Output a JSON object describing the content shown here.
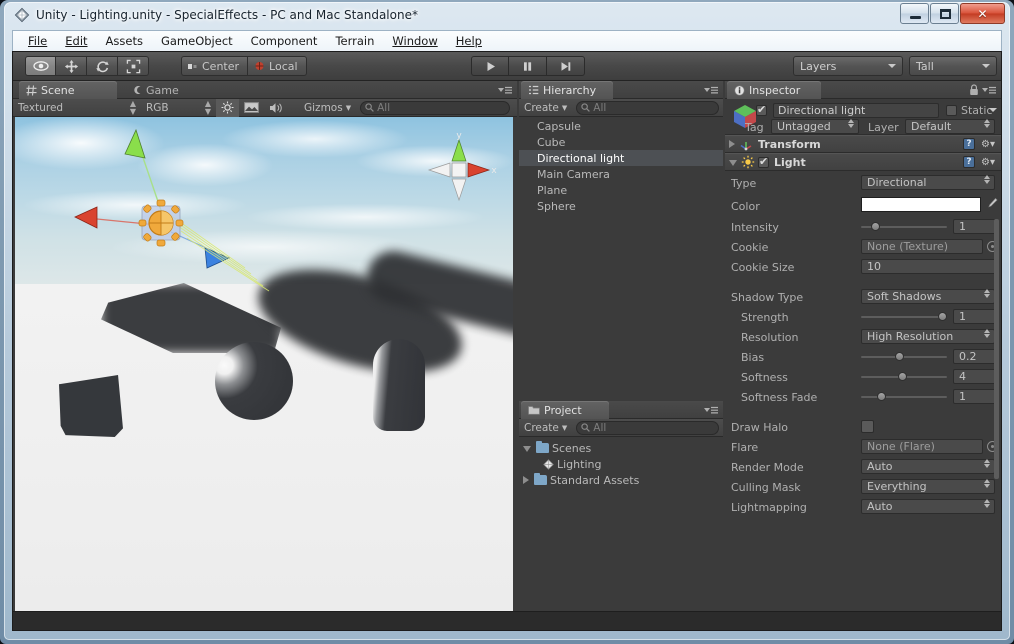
{
  "window": {
    "title": "Unity - Lighting.unity - SpecialEffects - PC and Mac Standalone*",
    "app_icon": "unity-logo-icon",
    "minimize_label": "Minimize",
    "maximize_label": "Maximize",
    "close_label": "✕"
  },
  "menu": {
    "items": [
      {
        "label": "File"
      },
      {
        "label": "Edit"
      },
      {
        "label": "Assets"
      },
      {
        "label": "GameObject"
      },
      {
        "label": "Component"
      },
      {
        "label": "Terrain"
      },
      {
        "label": "Window"
      },
      {
        "label": "Help"
      }
    ]
  },
  "toolbar": {
    "transform_tools": [
      {
        "name": "hand-tool",
        "icon": "eye-icon",
        "active": true
      },
      {
        "name": "move-tool",
        "icon": "move-arrows-icon",
        "active": false
      },
      {
        "name": "rotate-tool",
        "icon": "rotate-icon",
        "active": false
      },
      {
        "name": "scale-tool",
        "icon": "scale-icon",
        "active": false
      }
    ],
    "pivot_label": "Center",
    "rotation_label": "Local",
    "play_label": "play-icon",
    "pause_label": "pause-icon",
    "step_label": "step-icon",
    "layers_label": "Layers",
    "layout_label": "Tall"
  },
  "scene_panel": {
    "tabs": [
      {
        "label": "Scene",
        "icon": "grid-icon",
        "active": true
      },
      {
        "label": "Game",
        "icon": "gamepad-icon",
        "active": false
      }
    ],
    "draw_mode": "Textured",
    "render_mode": "RGB",
    "toggles": [
      {
        "name": "lighting-toggle",
        "icon": "sun-icon",
        "active": true
      },
      {
        "name": "skybox-toggle",
        "icon": "image-icon",
        "active": true
      },
      {
        "name": "audio-toggle",
        "icon": "speaker-icon",
        "active": false
      }
    ],
    "gizmos_label": "Gizmos",
    "search_placeholder": "All",
    "axis_gizmo": {
      "y_label": "y",
      "x_label": "x"
    }
  },
  "hierarchy_panel": {
    "tab_label": "Hierarchy",
    "tab_icon": "hierarchy-icon",
    "create_label": "Create",
    "search_placeholder": "All",
    "items": [
      {
        "label": "Capsule",
        "selected": false
      },
      {
        "label": "Cube",
        "selected": false
      },
      {
        "label": "Directional light",
        "selected": true
      },
      {
        "label": "Main Camera",
        "selected": false
      },
      {
        "label": "Plane",
        "selected": false
      },
      {
        "label": "Sphere",
        "selected": false
      }
    ]
  },
  "project_panel": {
    "tab_label": "Project",
    "tab_icon": "folder-icon",
    "create_label": "Create",
    "search_placeholder": "All",
    "items": [
      {
        "label": "Scenes",
        "type": "folder",
        "expanded": true,
        "depth": 0
      },
      {
        "label": "Lighting",
        "type": "scene",
        "expanded": false,
        "depth": 1
      },
      {
        "label": "Standard Assets",
        "type": "folder",
        "expanded": false,
        "depth": 0
      }
    ]
  },
  "inspector_panel": {
    "tab_label": "Inspector",
    "tab_icon": "info-icon",
    "lock_icon": "lock-icon",
    "object": {
      "enabled": true,
      "name": "Directional light",
      "static_label": "Static",
      "static_checked": false,
      "tag_label": "Tag",
      "tag_value": "Untagged",
      "layer_label": "Layer",
      "layer_value": "Default"
    },
    "components": [
      {
        "name": "Transform",
        "icon": "transform-icon",
        "expanded": false,
        "has_checkbox": false,
        "properties": []
      },
      {
        "name": "Light",
        "icon": "light-bulb-icon",
        "expanded": true,
        "has_checkbox": true,
        "checked": true,
        "properties": [
          {
            "label": "Type",
            "kind": "popup",
            "value": "Directional"
          },
          {
            "label": "Color",
            "kind": "color",
            "value": "#FFFFFF",
            "eyedropper": true
          },
          {
            "label": "Intensity",
            "kind": "slider",
            "value": "1",
            "fill": 0.16
          },
          {
            "label": "Cookie",
            "kind": "object",
            "value": "None (Texture)"
          },
          {
            "label": "Cookie Size",
            "kind": "text",
            "value": "10"
          },
          {
            "label": "Shadow Type",
            "kind": "popup",
            "value": "Soft Shadows"
          },
          {
            "label": "Strength",
            "kind": "slider",
            "value": "1",
            "fill": 0.94,
            "indent": true
          },
          {
            "label": "Resolution",
            "kind": "popup",
            "value": "High Resolution",
            "indent": true
          },
          {
            "label": "Bias",
            "kind": "slider",
            "value": "0.2",
            "fill": 0.4,
            "indent": true
          },
          {
            "label": "Softness",
            "kind": "slider",
            "value": "4",
            "fill": 0.43,
            "indent": true
          },
          {
            "label": "Softness Fade",
            "kind": "slider",
            "value": "1",
            "fill": 0.22,
            "indent": true
          },
          {
            "label": "Draw Halo",
            "kind": "checkbox",
            "value": "",
            "checked": false
          },
          {
            "label": "Flare",
            "kind": "object",
            "value": "None (Flare)"
          },
          {
            "label": "Render Mode",
            "kind": "popup",
            "value": "Auto"
          },
          {
            "label": "Culling Mask",
            "kind": "popup",
            "value": "Everything"
          },
          {
            "label": "Lightmapping",
            "kind": "popup",
            "value": "Auto"
          }
        ]
      }
    ]
  },
  "colors": {
    "editor_bg": "#3b3b3b",
    "panel_header": "#4a4a4a",
    "selection": "#4d5054",
    "text": "#b9b9b9",
    "light_color": "#FFFFFF",
    "gizmo_x": "#d9432f",
    "gizmo_y": "#8ade4b",
    "gizmo_z": "#3c82e0"
  }
}
